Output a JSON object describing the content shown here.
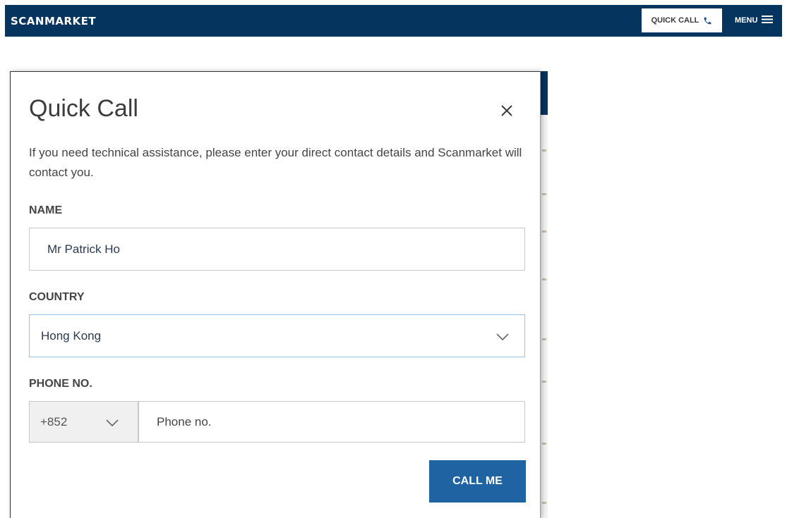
{
  "header": {
    "logo": "SCANMARKET",
    "quick_call_label": "QUICK CALL",
    "menu_label": "MENU",
    "background_color": "#05345f"
  },
  "modal": {
    "title": "Quick Call",
    "description": "If you need technical assistance, please enter your direct contact details and Scanmarket will contact you.",
    "name_label": "NAME",
    "name_value": "Mr Patrick Ho",
    "country_label": "COUNTRY",
    "country_value": "Hong Kong",
    "phone_label": "PHONE NO.",
    "phone_code": "+852",
    "phone_placeholder": "Phone no.",
    "submit_label": "CALL ME",
    "submit_color": "#1f63a3"
  },
  "icons": {
    "phone": "phone-icon",
    "menu": "hamburger-icon",
    "close": "close-icon",
    "dropdown": "chevron-down-icon"
  }
}
